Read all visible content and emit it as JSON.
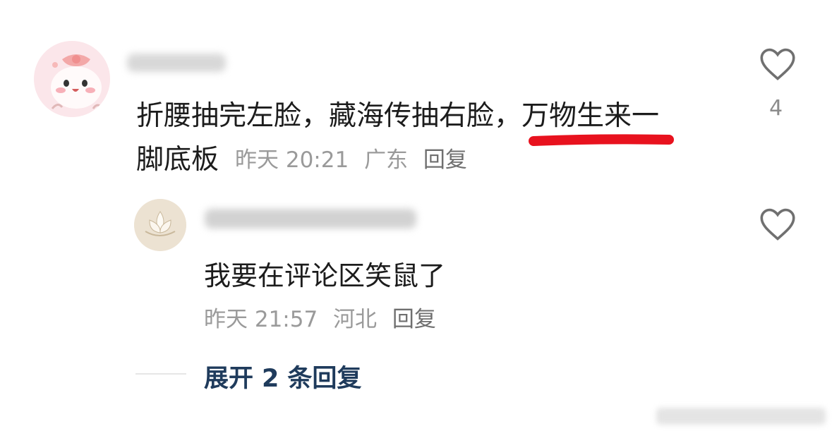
{
  "comment": {
    "text_line1": "折腰抽完左脸，藏海传抽右脸，万物生来一",
    "text_line2": "脚底板",
    "time": "昨天 20:21",
    "location": "广东",
    "reply_label": "回复",
    "like_count": "4"
  },
  "reply": {
    "text": "我要在评论区笑鼠了",
    "time": "昨天 21:57",
    "location": "河北",
    "reply_label": "回复"
  },
  "expand": {
    "label_prefix": "展开",
    "count": "2",
    "label_suffix": "条回复"
  },
  "icons": {
    "like": "heart-outline-icon",
    "reply_like": "heart-outline-icon"
  },
  "colors": {
    "underline": "#e8121e",
    "meta_text": "#9a9a9a",
    "expand_link": "#1f3b5c"
  }
}
